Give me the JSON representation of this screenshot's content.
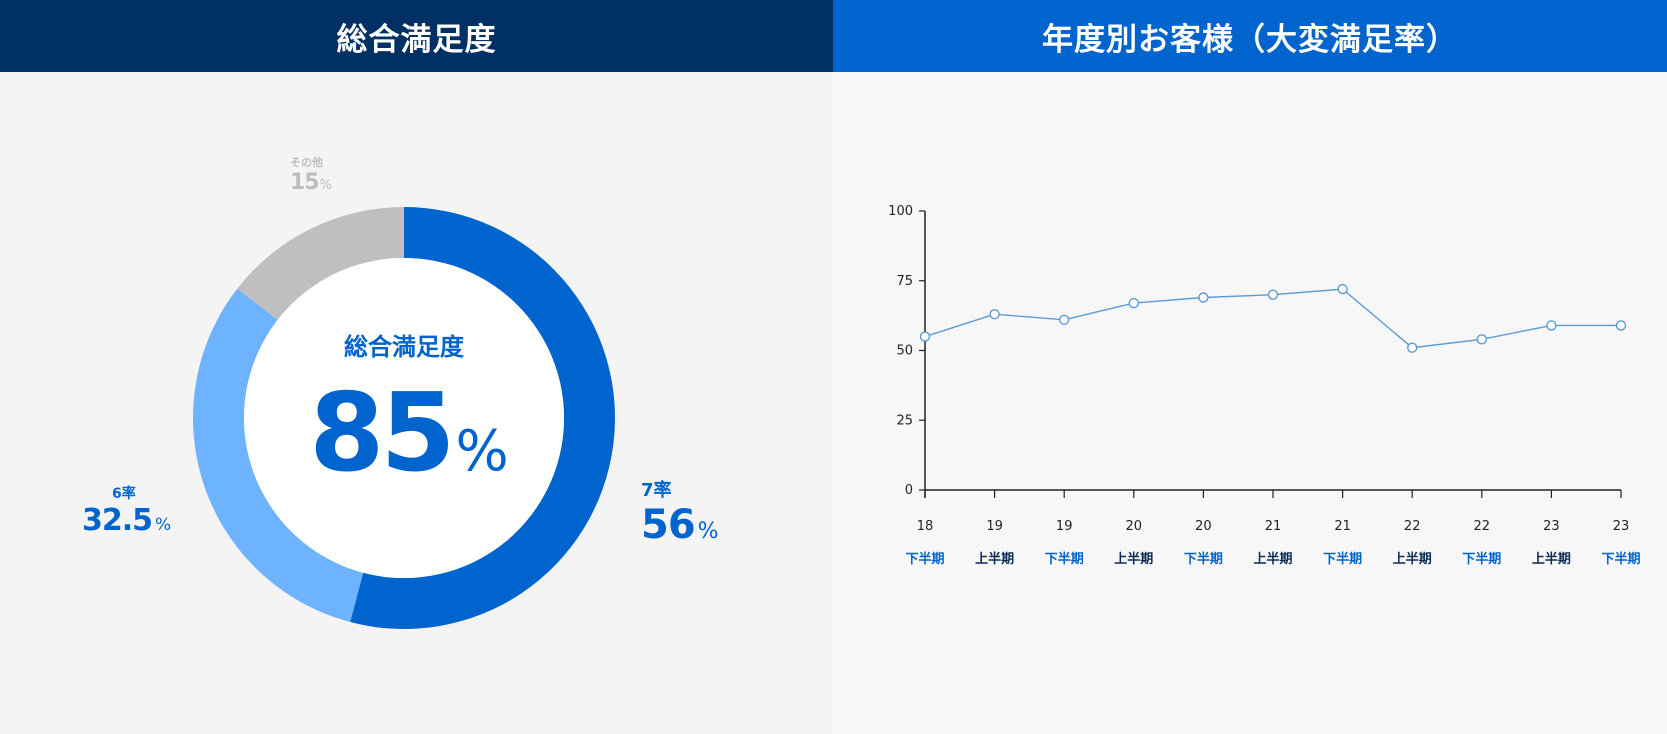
{
  "panels": {
    "left": {
      "title": "総合満足度"
    },
    "right": {
      "title": "年度別お客様（大変満足率）"
    }
  },
  "colors": {
    "navy": "#003064",
    "brand_blue": "#0064cf",
    "light_blue": "#6db3ff",
    "gray": "#bfbfbf",
    "line": "#5b9bd5",
    "half_lower": "#0064cf",
    "half_upper": "#0b2a55"
  },
  "donut": {
    "center_title": "総合満足度",
    "center_value": "85",
    "center_unit": "%",
    "labels": {
      "seven": {
        "name": "7率",
        "value": "56",
        "unit": "%"
      },
      "six": {
        "name": "6率",
        "value": "32.5",
        "unit": "%"
      },
      "other": {
        "name": "その他",
        "value": "15",
        "unit": "%"
      }
    }
  },
  "chart_data": [
    {
      "type": "pie",
      "title": "総合満足度",
      "subtype": "donut",
      "center_label": "85%",
      "slices": [
        {
          "name": "7率",
          "value": 56,
          "color": "#0064cf"
        },
        {
          "name": "6率",
          "value": 32.5,
          "color": "#6db3ff"
        },
        {
          "name": "その他",
          "value": 15,
          "color": "#bfbfbf"
        }
      ],
      "start": "top",
      "direction": "clockwise"
    },
    {
      "type": "line",
      "title": "年度別お客様（大変満足率）",
      "xlabel": "",
      "ylabel": "",
      "ylim": [
        0,
        100
      ],
      "yticks": [
        0,
        25,
        50,
        75,
        100
      ],
      "grid": false,
      "x_years": [
        "18",
        "19",
        "19",
        "20",
        "20",
        "21",
        "21",
        "22",
        "22",
        "23",
        "23"
      ],
      "x_halves": [
        "下半期",
        "上半期",
        "下半期",
        "上半期",
        "下半期",
        "上半期",
        "下半期",
        "上半期",
        "下半期",
        "上半期",
        "下半期"
      ],
      "series": [
        {
          "name": "大変満足率",
          "values": [
            55,
            63,
            61,
            67,
            69,
            70,
            72,
            51,
            54,
            59,
            59
          ],
          "color": "#5b9bd5",
          "marker": "open-circle"
        }
      ]
    }
  ]
}
